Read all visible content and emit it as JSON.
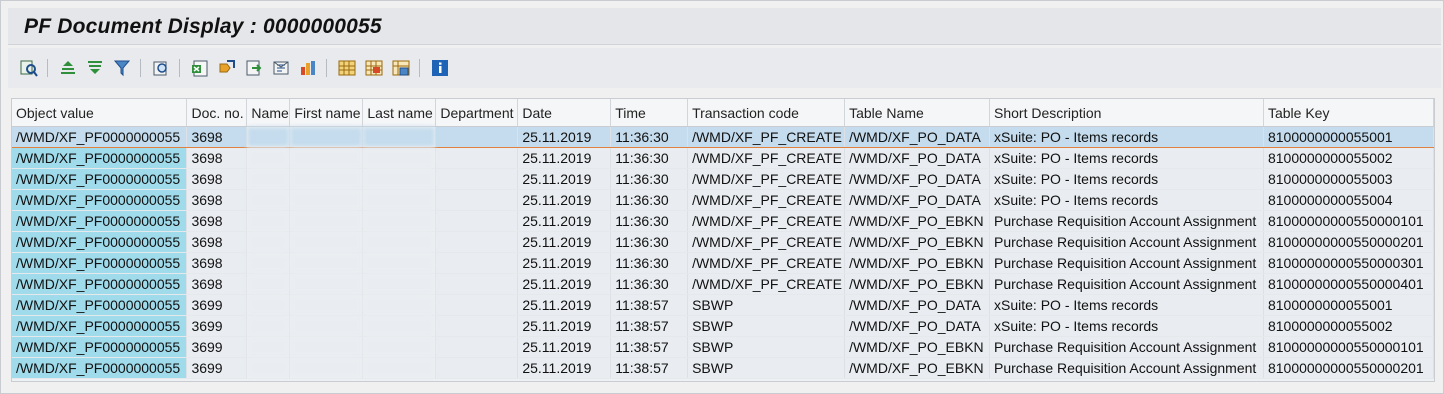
{
  "window": {
    "title": "PF Document Display : 0000000055"
  },
  "toolbar": {
    "buttons": [
      {
        "icon": "details-icon",
        "label": "Details"
      },
      {
        "icon": "sort-ascending-icon",
        "label": "Sort ascending"
      },
      {
        "icon": "sort-descending-icon",
        "label": "Sort descending"
      },
      {
        "icon": "filter-icon",
        "label": "Filter"
      },
      {
        "icon": "print-preview-icon",
        "label": "Print preview"
      },
      {
        "icon": "export-spreadsheet-icon",
        "label": "Spreadsheet"
      },
      {
        "icon": "word-processing-icon",
        "label": "Word processing"
      },
      {
        "icon": "local-file-icon",
        "label": "Local file"
      },
      {
        "icon": "send-icon",
        "label": "Send"
      },
      {
        "icon": "graphic-icon",
        "label": "Graphic"
      },
      {
        "icon": "change-layout-icon",
        "label": "Change layout"
      },
      {
        "icon": "select-layout-icon",
        "label": "Select layout"
      },
      {
        "icon": "save-layout-icon",
        "label": "Save layout"
      },
      {
        "icon": "info-icon",
        "label": "Information"
      }
    ]
  },
  "grid": {
    "columns": [
      "Object value",
      "Doc. no.",
      "Name",
      "First name",
      "Last name",
      "Department",
      "Date",
      "Time",
      "Transaction code",
      "Table Name",
      "Short Description",
      "Table Key"
    ],
    "rows": [
      [
        "/WMD/XF_PF0000000055",
        "3698",
        "",
        "",
        "",
        "",
        "25.11.2019",
        "11:36:30",
        "/WMD/XF_PF_CREATE",
        "/WMD/XF_PO_DATA",
        "xSuite: PO - Items records",
        "8100000000055001"
      ],
      [
        "/WMD/XF_PF0000000055",
        "3698",
        "",
        "",
        "",
        "",
        "25.11.2019",
        "11:36:30",
        "/WMD/XF_PF_CREATE",
        "/WMD/XF_PO_DATA",
        "xSuite: PO - Items records",
        "8100000000055002"
      ],
      [
        "/WMD/XF_PF0000000055",
        "3698",
        "",
        "",
        "",
        "",
        "25.11.2019",
        "11:36:30",
        "/WMD/XF_PF_CREATE",
        "/WMD/XF_PO_DATA",
        "xSuite: PO - Items records",
        "8100000000055003"
      ],
      [
        "/WMD/XF_PF0000000055",
        "3698",
        "",
        "",
        "",
        "",
        "25.11.2019",
        "11:36:30",
        "/WMD/XF_PF_CREATE",
        "/WMD/XF_PO_DATA",
        "xSuite: PO - Items records",
        "8100000000055004"
      ],
      [
        "/WMD/XF_PF0000000055",
        "3698",
        "",
        "",
        "",
        "",
        "25.11.2019",
        "11:36:30",
        "/WMD/XF_PF_CREATE",
        "/WMD/XF_PO_EBKN",
        "Purchase Requisition Account Assignment",
        "81000000000550000101"
      ],
      [
        "/WMD/XF_PF0000000055",
        "3698",
        "",
        "",
        "",
        "",
        "25.11.2019",
        "11:36:30",
        "/WMD/XF_PF_CREATE",
        "/WMD/XF_PO_EBKN",
        "Purchase Requisition Account Assignment",
        "81000000000550000201"
      ],
      [
        "/WMD/XF_PF0000000055",
        "3698",
        "",
        "",
        "",
        "",
        "25.11.2019",
        "11:36:30",
        "/WMD/XF_PF_CREATE",
        "/WMD/XF_PO_EBKN",
        "Purchase Requisition Account Assignment",
        "81000000000550000301"
      ],
      [
        "/WMD/XF_PF0000000055",
        "3698",
        "",
        "",
        "",
        "",
        "25.11.2019",
        "11:36:30",
        "/WMD/XF_PF_CREATE",
        "/WMD/XF_PO_EBKN",
        "Purchase Requisition Account Assignment",
        "81000000000550000401"
      ],
      [
        "/WMD/XF_PF0000000055",
        "3699",
        "",
        "",
        "",
        "",
        "25.11.2019",
        "11:38:57",
        "SBWP",
        "/WMD/XF_PO_DATA",
        "xSuite: PO - Items records",
        "8100000000055001"
      ],
      [
        "/WMD/XF_PF0000000055",
        "3699",
        "",
        "",
        "",
        "",
        "25.11.2019",
        "11:38:57",
        "SBWP",
        "/WMD/XF_PO_DATA",
        "xSuite: PO - Items records",
        "8100000000055002"
      ],
      [
        "/WMD/XF_PF0000000055",
        "3699",
        "",
        "",
        "",
        "",
        "25.11.2019",
        "11:38:57",
        "SBWP",
        "/WMD/XF_PO_EBKN",
        "Purchase Requisition Account Assignment",
        "81000000000550000101"
      ],
      [
        "/WMD/XF_PF0000000055",
        "3699",
        "",
        "",
        "",
        "",
        "25.11.2019",
        "11:38:57",
        "SBWP",
        "/WMD/XF_PO_EBKN",
        "Purchase Requisition Account Assignment",
        "81000000000550000201"
      ]
    ],
    "selected_row": 0
  },
  "colors": {
    "key_column": "#9fdbeb",
    "selected_row": "#c4dced",
    "selection_border": "#e0813e"
  }
}
